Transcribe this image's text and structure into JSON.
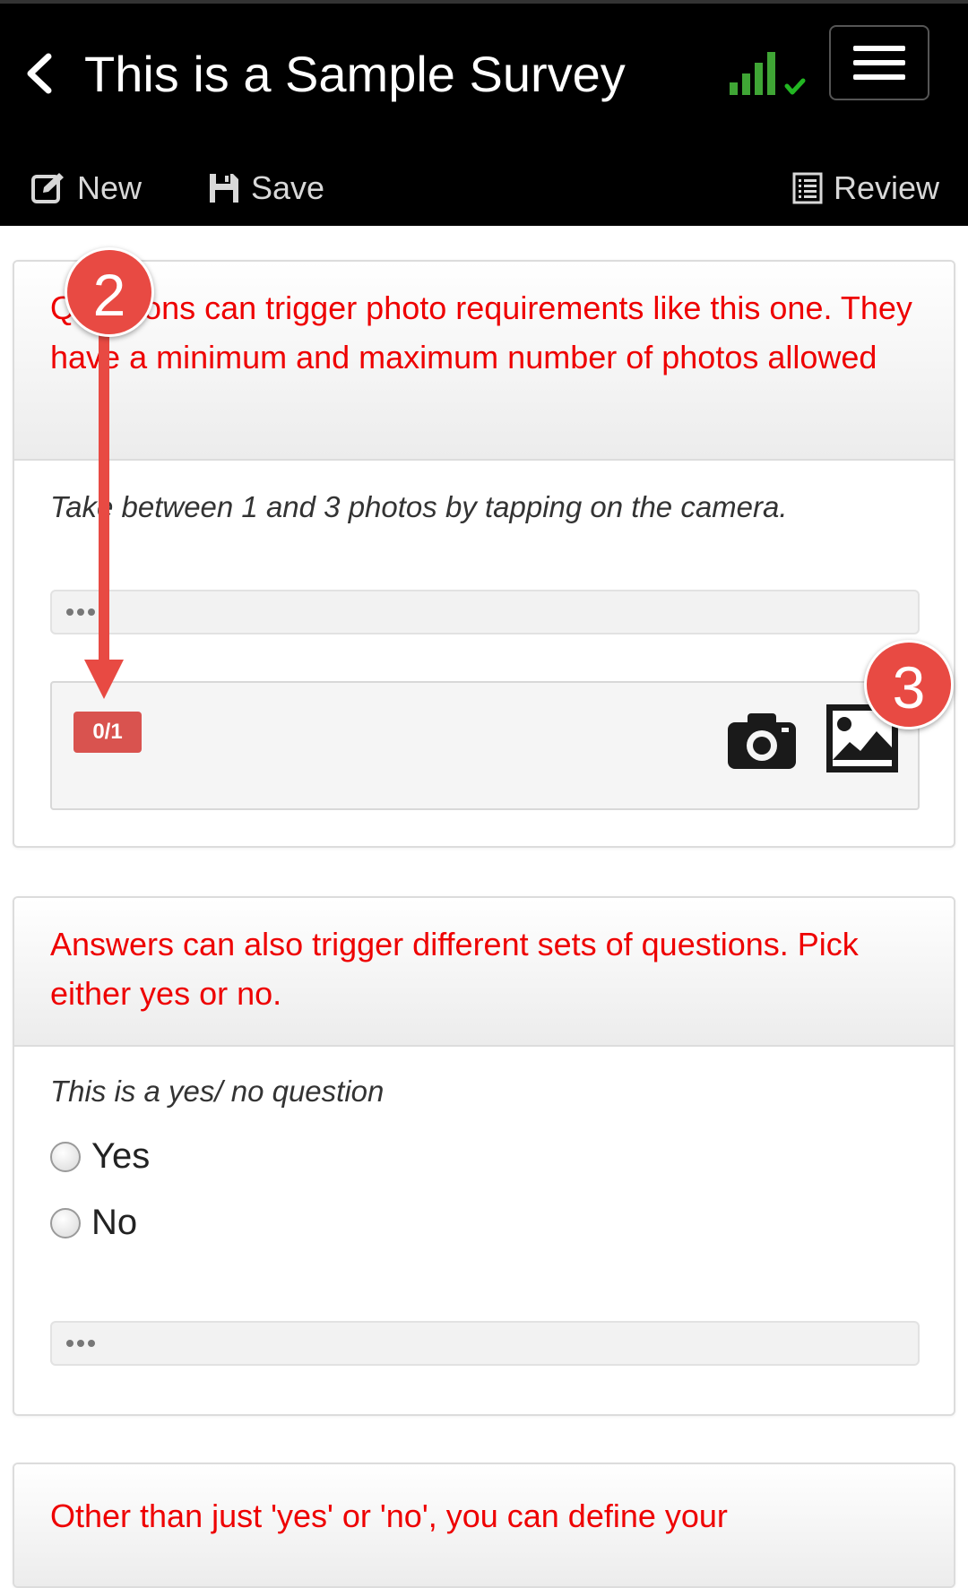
{
  "header": {
    "title": "This is a Sample Survey",
    "back_icon": "chevron-left-icon",
    "signal_icon": "signal-strength-icon",
    "menu_icon": "hamburger-menu-icon"
  },
  "toolbar": {
    "new_label": "New",
    "save_label": "Save",
    "review_label": "Review"
  },
  "cards": [
    {
      "heading": "Questions can trigger photo requirements like this one. They have a minimum and maximum number of photos allowed",
      "prompt": "Take between 1 and 3 photos by tapping on the camera.",
      "photo_count": "0/1"
    },
    {
      "heading": "Answers can also trigger different sets of questions. Pick either yes or no.",
      "prompt": "This is a yes/ no question",
      "options": [
        "Yes",
        "No"
      ]
    },
    {
      "heading": "Other than just 'yes' or 'no', you can define your"
    }
  ],
  "annotations": {
    "callout_2": "2",
    "callout_3": "3"
  },
  "colors": {
    "header_bg": "#000000",
    "question_text": "#ee0000",
    "badge_bg": "#d9534f",
    "callout_bg": "#e84a43",
    "signal_green": "#3fa535"
  }
}
